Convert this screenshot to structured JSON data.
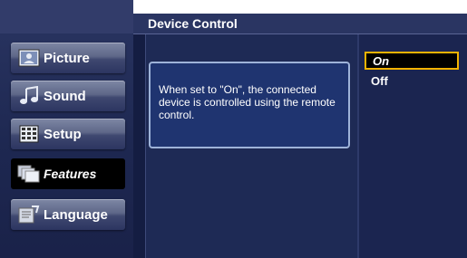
{
  "header": {
    "title": "Device Control"
  },
  "sidebar": {
    "items": [
      {
        "label": "Picture",
        "icon": "picture-icon",
        "active": false
      },
      {
        "label": "Sound",
        "icon": "music-note-icon",
        "active": false
      },
      {
        "label": "Setup",
        "icon": "setup-grid-icon",
        "active": false
      },
      {
        "label": "Features",
        "icon": "features-folders-icon",
        "active": true
      },
      {
        "label": "Language",
        "icon": "language-icon",
        "active": false
      }
    ]
  },
  "info": {
    "text": "When set to \"On\", the connected device is controlled using the remote control."
  },
  "options": [
    {
      "label": "On",
      "selected": true
    },
    {
      "label": "Off",
      "selected": false
    }
  ],
  "colors": {
    "highlight_border": "#f2b300",
    "panel_bg": "#1e2a55",
    "info_border": "#9eb3d9"
  }
}
